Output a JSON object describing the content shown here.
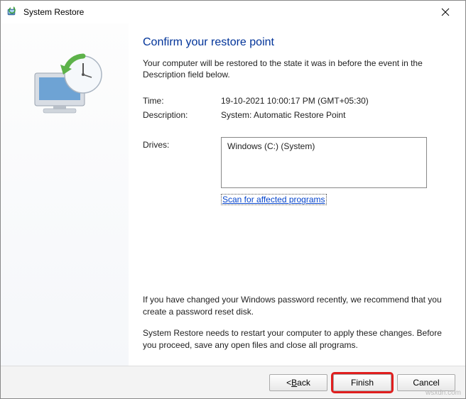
{
  "window": {
    "title": "System Restore"
  },
  "content": {
    "heading": "Confirm your restore point",
    "intro": "Your computer will be restored to the state it was in before the event in the Description field below.",
    "time_label": "Time:",
    "time_value": "19-10-2021 10:00:17 PM (GMT+05:30)",
    "description_label": "Description:",
    "description_value": "System: Automatic Restore Point",
    "drives_label": "Drives:",
    "drives_value": "Windows (C:) (System)",
    "scan_link_text": "Scan for affected programs",
    "note_password": "If you have changed your Windows password recently, we recommend that you create a password reset disk.",
    "note_restart": "System Restore needs to restart your computer to apply these changes. Before you proceed, save any open files and close all programs."
  },
  "buttons": {
    "back_prefix": "< ",
    "back_key": "B",
    "back_suffix": "ack",
    "finish": "Finish",
    "cancel": "Cancel"
  },
  "watermark": "wsxdn.com"
}
